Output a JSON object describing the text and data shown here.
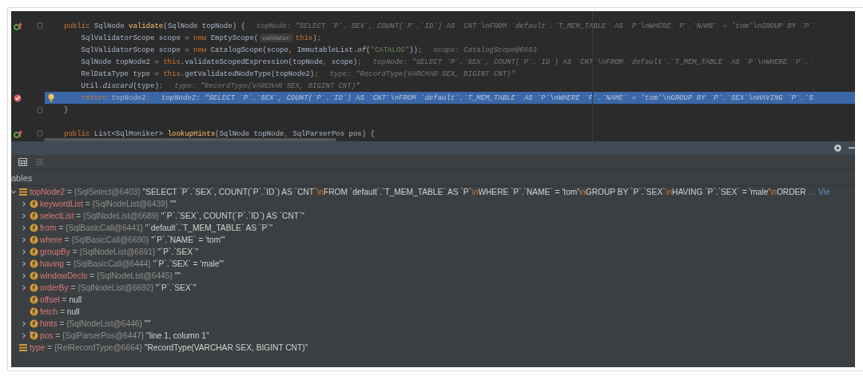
{
  "editor": {
    "lines": [
      {
        "kind": "signature",
        "tokens": [
          {
            "kind": "kw",
            "text": "public"
          },
          {
            "kind": "plain",
            "text": " SqlNode "
          },
          {
            "kind": "method",
            "text": "validate"
          },
          {
            "kind": "plain",
            "text": "(SqlNode topNode) {"
          }
        ],
        "hint": "topNode: \"SELECT `P`.`SEX`, COUNT(`P`.`ID`) AS `CNT`\\nFROM `default`.`T_MEM_TABLE` AS `P`\\nWHERE `P`.`NAME` = 'tom'\\nGROUP BY `P`"
      },
      {
        "kind": "statement",
        "tokens": [
          {
            "kind": "plain",
            "text": "SqlValidatorScope scope = "
          },
          {
            "kind": "kw",
            "text": "new"
          },
          {
            "kind": "plain",
            "text": " EmptyScope("
          },
          {
            "kind": "param",
            "text": "validator:"
          },
          {
            "kind": "kw",
            "text": "this"
          },
          {
            "kind": "plain",
            "text": ")"
          },
          {
            "kind": "punct",
            "text": ";"
          }
        ]
      },
      {
        "kind": "statement",
        "tokens": [
          {
            "kind": "plain",
            "text": "SqlValidatorScope scope = "
          },
          {
            "kind": "kw",
            "text": "new"
          },
          {
            "kind": "plain",
            "text": " CatalogScope(scope"
          },
          {
            "kind": "punct",
            "text": ","
          },
          {
            "kind": "plain",
            "text": " ImmutableList."
          },
          {
            "kind": "italic",
            "text": "of"
          },
          {
            "kind": "plain",
            "text": "("
          },
          {
            "kind": "string",
            "text": "\"CATALOG\""
          },
          {
            "kind": "plain",
            "text": "))"
          },
          {
            "kind": "punct",
            "text": ";"
          }
        ],
        "hint": "scope: CatalogScope@6663"
      },
      {
        "kind": "statement",
        "tokens": [
          {
            "kind": "plain",
            "text": "SqlNode topNode2 = "
          },
          {
            "kind": "kw",
            "text": "this"
          },
          {
            "kind": "plain",
            "text": ".validateScopedExpression(topNode"
          },
          {
            "kind": "punct",
            "text": ","
          },
          {
            "kind": "plain",
            "text": " scope)"
          },
          {
            "kind": "punct",
            "text": ";"
          }
        ],
        "hint": "topNode: \"SELECT `P`.`SEX`, COUNT(`P`.`ID`) AS `CNT`\\nFROM `default`.`T_MEM_TABLE` AS `P`\\nWHERE `P`.`"
      },
      {
        "kind": "statement",
        "tokens": [
          {
            "kind": "plain",
            "text": "RelDataType type = "
          },
          {
            "kind": "kw",
            "text": "this"
          },
          {
            "kind": "plain",
            "text": ".getValidatedNodeType(topNode2)"
          },
          {
            "kind": "punct",
            "text": ";"
          }
        ],
        "hint": "type: \"RecordType(VARCHAR SEX, BIGINT CNT)\""
      },
      {
        "kind": "statement",
        "tokens": [
          {
            "kind": "plain",
            "text": "Util."
          },
          {
            "kind": "italic",
            "text": "discard"
          },
          {
            "kind": "plain",
            "text": "(type)"
          },
          {
            "kind": "punct",
            "text": ";"
          }
        ],
        "hint": "type: \"RecordType(VARCHAR SEX, BIGINT CNT)\""
      },
      {
        "kind": "current",
        "tokens": [
          {
            "kind": "kw",
            "text": "return"
          },
          {
            "kind": "plain",
            "text": " topNode2"
          },
          {
            "kind": "punct",
            "text": ";"
          }
        ],
        "hint": "topNode2: \"SELECT `P`.`SEX`, COUNT(`P`.`ID`) AS `CNT`\\nFROM `default`.`T_MEM_TABLE` AS `P`\\nWHERE `P`.`NAME` = 'tom'\\nGROUP BY `P`.`SEX`\\nHAVING `P`.`S"
      },
      {
        "kind": "closing",
        "tokens": [
          {
            "kind": "plain",
            "text": "}"
          }
        ]
      },
      {
        "kind": "blank"
      },
      {
        "kind": "signature",
        "tokens": [
          {
            "kind": "kw",
            "text": "public"
          },
          {
            "kind": "plain",
            "text": " List<SqlMoniker> "
          },
          {
            "kind": "method",
            "text": "lookupHints"
          },
          {
            "kind": "plain",
            "text": "(SqlNode topNode"
          },
          {
            "kind": "punct",
            "text": ","
          },
          {
            "kind": "plain",
            "text": " SqlParserPos pos) {"
          }
        ]
      }
    ]
  },
  "toolbar": {
    "buttons": [
      {
        "kind": "table",
        "disabled": false
      },
      {
        "kind": "filter",
        "disabled": true
      }
    ]
  },
  "variables_tab": {
    "label": "ables"
  },
  "variables": [
    {
      "kind": "local",
      "expanded": true,
      "name": "topNode2",
      "eq": "=",
      "ref": "{SqlSelect@6403}",
      "value": [
        {
          "kind": "text",
          "text": "\"SELECT `P`.`SEX`, COUNT(`P`.`ID`) AS `CNT`"
        },
        {
          "kind": "escape",
          "text": "\\n"
        },
        {
          "kind": "text",
          "text": "FROM `default`.`T_MEM_TABLE` AS `P`"
        },
        {
          "kind": "escape",
          "text": "\\n"
        },
        {
          "kind": "text",
          "text": "WHERE `P`.`NAME` = 'tom'"
        },
        {
          "kind": "escape",
          "text": "\\n"
        },
        {
          "kind": "text",
          "text": "GROUP BY `P`.`SEX`"
        },
        {
          "kind": "escape",
          "text": "\\n"
        },
        {
          "kind": "text",
          "text": "HAVING `P`.`SEX` = 'male'"
        },
        {
          "kind": "escape",
          "text": "\\n"
        },
        {
          "kind": "text",
          "text": "ORDER"
        }
      ],
      "link": "... Vie",
      "children": [
        {
          "kind": "field",
          "expanded": false,
          "name": "keywordList",
          "eq": "=",
          "ref": "{SqlNodeList@6439}",
          "value": [
            {
              "kind": "text",
              "text": "\"\""
            }
          ]
        },
        {
          "kind": "field",
          "expanded": false,
          "name": "selectList",
          "eq": "=",
          "ref": "{SqlNodeList@6689}",
          "value": [
            {
              "kind": "text",
              "text": "\"`P`.`SEX`, COUNT(`P`.`ID`) AS `CNT`\""
            }
          ]
        },
        {
          "kind": "field",
          "expanded": false,
          "name": "from",
          "eq": "=",
          "ref": "{SqlBasicCall@6441}",
          "value": [
            {
              "kind": "text",
              "text": "\"`default`.`T_MEM_TABLE` AS `P`\""
            }
          ]
        },
        {
          "kind": "field",
          "expanded": false,
          "name": "where",
          "eq": "=",
          "ref": "{SqlBasicCall@6690}",
          "value": [
            {
              "kind": "text",
              "text": "\"`P`.`NAME` = 'tom'\""
            }
          ]
        },
        {
          "kind": "field",
          "expanded": false,
          "name": "groupBy",
          "eq": "=",
          "ref": "{SqlNodeList@6691}",
          "value": [
            {
              "kind": "text",
              "text": "\"`P`.`SEX`\""
            }
          ]
        },
        {
          "kind": "field",
          "expanded": false,
          "name": "having",
          "eq": "=",
          "ref": "{SqlBasicCall@6444}",
          "value": [
            {
              "kind": "text",
              "text": "\"`P`.`SEX` = 'male'\""
            }
          ]
        },
        {
          "kind": "field",
          "expanded": false,
          "name": "windowDecls",
          "eq": "=",
          "ref": "{SqlNodeList@6445}",
          "value": [
            {
              "kind": "text",
              "text": "\"\""
            }
          ]
        },
        {
          "kind": "field",
          "expanded": false,
          "name": "orderBy",
          "eq": "=",
          "ref": "{SqlNodeList@6692}",
          "value": [
            {
              "kind": "text",
              "text": "\"`P`.`SEX`\""
            }
          ]
        },
        {
          "kind": "field",
          "name": "offset",
          "eq": "=",
          "value": [
            {
              "kind": "text",
              "text": "null"
            }
          ]
        },
        {
          "kind": "field",
          "name": "fetch",
          "eq": "=",
          "value": [
            {
              "kind": "text",
              "text": "null"
            }
          ]
        },
        {
          "kind": "field",
          "expanded": false,
          "name": "hints",
          "eq": "=",
          "ref": "{SqlNodeList@6446}",
          "value": [
            {
              "kind": "text",
              "text": "\"\""
            }
          ]
        },
        {
          "kind": "field_marked",
          "expanded": false,
          "name": "pos",
          "eq": "=",
          "ref": "{SqlParserPos@6447}",
          "value": [
            {
              "kind": "text",
              "text": "\"line 1, column 1\""
            }
          ]
        }
      ]
    },
    {
      "kind": "local",
      "name": "type",
      "eq": "=",
      "ref": "{RelRecordType@6664}",
      "value": [
        {
          "kind": "text",
          "text": "\"RecordType(VARCHAR SEX, BIGINT CNT)\""
        }
      ]
    }
  ]
}
